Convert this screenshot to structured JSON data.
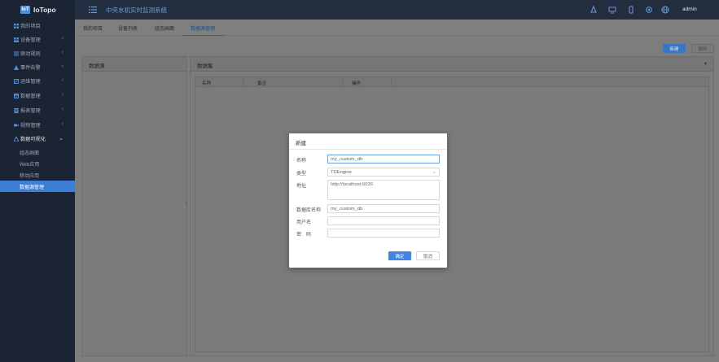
{
  "app": {
    "logo_mark": "IoT",
    "name": "IoTopo",
    "system_title": "中央水机实时监测系统",
    "username": "admin"
  },
  "sidebar": {
    "items": [
      {
        "label": "我的项目",
        "icon": "grid-icon"
      },
      {
        "label": "设备管理",
        "icon": "devices-icon"
      },
      {
        "label": "联动规则",
        "icon": "rules-icon"
      },
      {
        "label": "事件告警",
        "icon": "alert-icon"
      },
      {
        "label": "运维管理",
        "icon": "wrench-icon"
      },
      {
        "label": "数据管理",
        "icon": "chart-icon"
      },
      {
        "label": "报表管理",
        "icon": "report-icon"
      },
      {
        "label": "视频管理",
        "icon": "video-icon"
      },
      {
        "label": "数据可视化",
        "icon": "visual-icon"
      }
    ],
    "sub_items": [
      "组态画面",
      "Web应用",
      "移动应用",
      "数据源管理"
    ]
  },
  "tabs": [
    "我的项目",
    "设备列表",
    "组态画面",
    "数据源管理"
  ],
  "toolbar": {
    "new_label": "新建",
    "delete_label": "删除"
  },
  "datasource_panel": {
    "title": "数据源"
  },
  "dataset_panel": {
    "title": "数据集",
    "caret": "▾",
    "columns": [
      "名称",
      "备注",
      "操作"
    ]
  },
  "modal": {
    "title": "新建",
    "fields": {
      "name_label": "名称",
      "name_value": "my_custom_db",
      "type_label": "类型",
      "type_value": "TDEngine",
      "addr_label": "地址",
      "addr_value": "http://localhost:6020",
      "dbname_label": "数据库名称",
      "dbname_value": "my_custom_db",
      "user_label": "用户名",
      "user_value": "",
      "pwd_label": "密　码",
      "pwd_value": ""
    },
    "ok_label": "确定",
    "cancel_label": "取消"
  },
  "colors": {
    "sidebar_bg": "#1b2432",
    "header_bg": "#222e3f",
    "accent": "#3d7fd6",
    "overlay": "#7d7d7d"
  }
}
